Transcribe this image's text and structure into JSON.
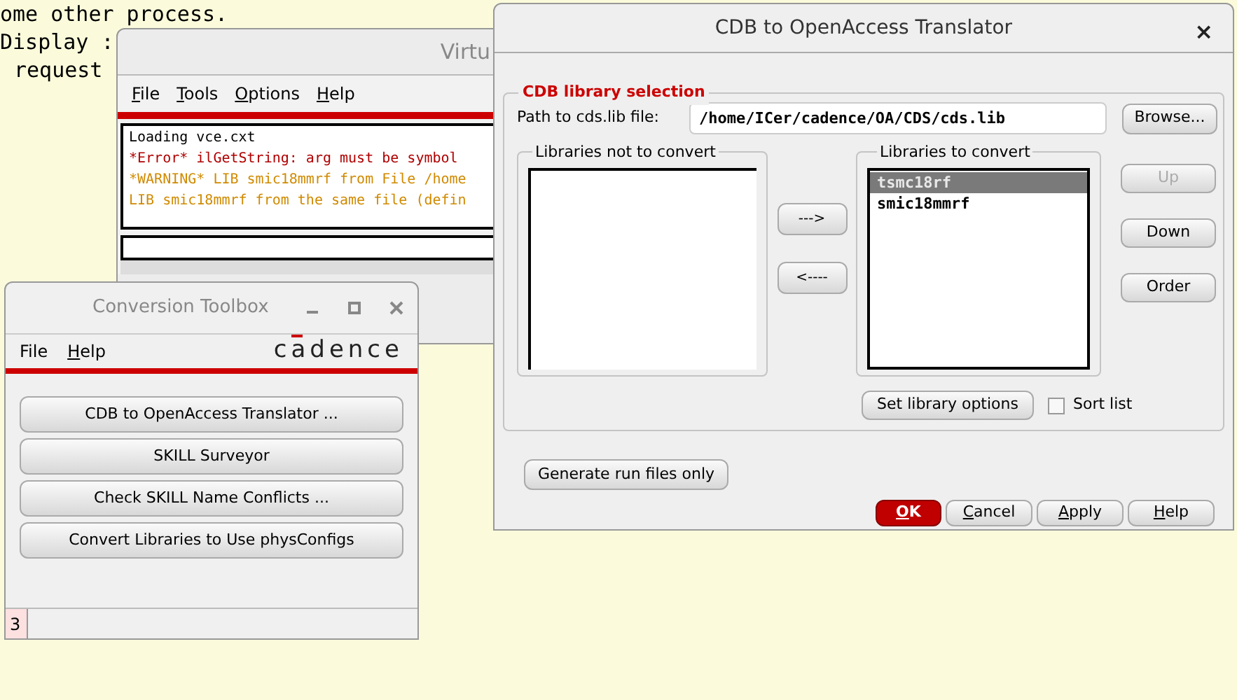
{
  "terminal": {
    "lines": [
      "ome other process.",
      "Display :",
      "request"
    ]
  },
  "virtuoso_window": {
    "title": "Virtu",
    "menu": [
      {
        "label": "File",
        "underlined": true
      },
      {
        "label": "Tools",
        "underlined": true
      },
      {
        "label": "Options",
        "underlined": true
      },
      {
        "label": "Help",
        "underlined": true
      }
    ],
    "log": [
      {
        "kind": "info",
        "text": "Loading vce.cxt"
      },
      {
        "kind": "error",
        "text": "*Error* ilGetString: arg must be symbol"
      },
      {
        "kind": "warning",
        "text": "*WARNING* LIB smic18mmrf from File /home"
      },
      {
        "kind": "warning",
        "text": "LIB smic18mmrf from the same file (defin"
      }
    ]
  },
  "conversion_toolbox": {
    "title": "Conversion Toolbox",
    "menu": [
      {
        "label": "File",
        "underlined": false
      },
      {
        "label": "Help",
        "underlined": true
      }
    ],
    "logo": "cadence",
    "buttons": [
      "CDB to OpenAccess Translator ...",
      "SKILL Surveyor",
      "Check SKILL Name Conflicts ...",
      "Convert Libraries to Use physConfigs"
    ],
    "status": "3"
  },
  "translator_dialog": {
    "title": "CDB to OpenAccess Translator",
    "close": "×",
    "group_title": "CDB library selection",
    "path_label": "Path to cds.lib file:",
    "path_value": "/home/ICer/cadence/OA/CDS/cds.lib",
    "browse": "Browse...",
    "left_list": {
      "title": "Libraries not to convert"
    },
    "right_list": {
      "title": "Libraries to convert",
      "items": [
        {
          "label": "tsmc18rf",
          "selected": true
        },
        {
          "label": "smic18mmrf",
          "selected": false
        }
      ]
    },
    "move_buttons": [
      "--->",
      "<----"
    ],
    "side_buttons": [
      {
        "label": "Up",
        "disabled": true
      },
      {
        "label": "Down",
        "disabled": false
      },
      {
        "label": "Order",
        "disabled": false
      }
    ],
    "library_options": "Set library options",
    "sort_list": {
      "label": "Sort list",
      "checked": false
    },
    "generate": "Generate run files only",
    "footer_buttons": [
      {
        "label": "OK",
        "kind": "default",
        "underlined": true
      },
      {
        "label": "Cancel",
        "kind": "normal",
        "underlined": true
      },
      {
        "label": "Apply",
        "kind": "normal",
        "underlined": true
      },
      {
        "label": "Help",
        "kind": "normal",
        "underlined": true
      }
    ]
  }
}
